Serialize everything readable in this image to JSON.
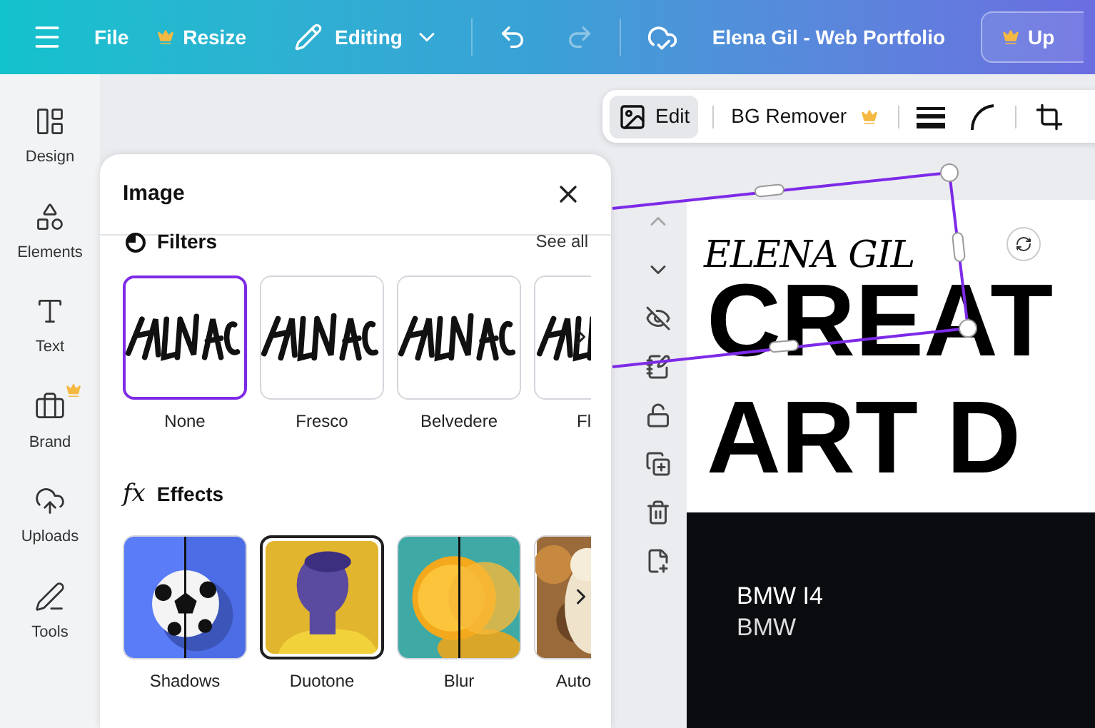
{
  "top_bar": {
    "menu_items": [
      {
        "label": "File",
        "premium": false
      },
      {
        "label": "Resize",
        "premium": true
      }
    ],
    "mode_button": "Editing",
    "undo": {
      "disabled": false
    },
    "redo": {
      "disabled": true
    },
    "document_title": "Elena Gil - Web Portfolio",
    "upgrade_button": {
      "label": "Up",
      "premium": true
    }
  },
  "sidebar": {
    "items": [
      {
        "label": "Design",
        "premium": false
      },
      {
        "label": "Elements",
        "premium": false
      },
      {
        "label": "Text",
        "premium": false
      },
      {
        "label": "Brand",
        "premium": true
      },
      {
        "label": "Uploads",
        "premium": false
      },
      {
        "label": "Tools",
        "premium": false
      }
    ]
  },
  "image_toolbar": {
    "edit_button": {
      "label": "Edit",
      "selected": true
    },
    "bg_remover": {
      "label": "BG Remover",
      "premium": true
    }
  },
  "panel": {
    "title": "Image",
    "filters": {
      "heading": "Filters",
      "see_all": "See all",
      "items": [
        {
          "label": "None",
          "selected": true
        },
        {
          "label": "Fresco",
          "selected": false
        },
        {
          "label": "Belvedere",
          "selected": false
        },
        {
          "label": "Fl",
          "selected": false
        }
      ]
    },
    "effects": {
      "symbol": "fx",
      "heading": "Effects",
      "items": [
        {
          "label": "Shadows",
          "selected": false
        },
        {
          "label": "Duotone",
          "selected": true
        },
        {
          "label": "Blur",
          "selected": false
        },
        {
          "label": "Auto",
          "selected": false
        }
      ]
    }
  },
  "page": {
    "signature": "ELENA GIL",
    "headline": [
      "CREAT",
      "ART D"
    ],
    "card": {
      "title": "BMW I4",
      "subtitle": "BMW"
    }
  }
}
